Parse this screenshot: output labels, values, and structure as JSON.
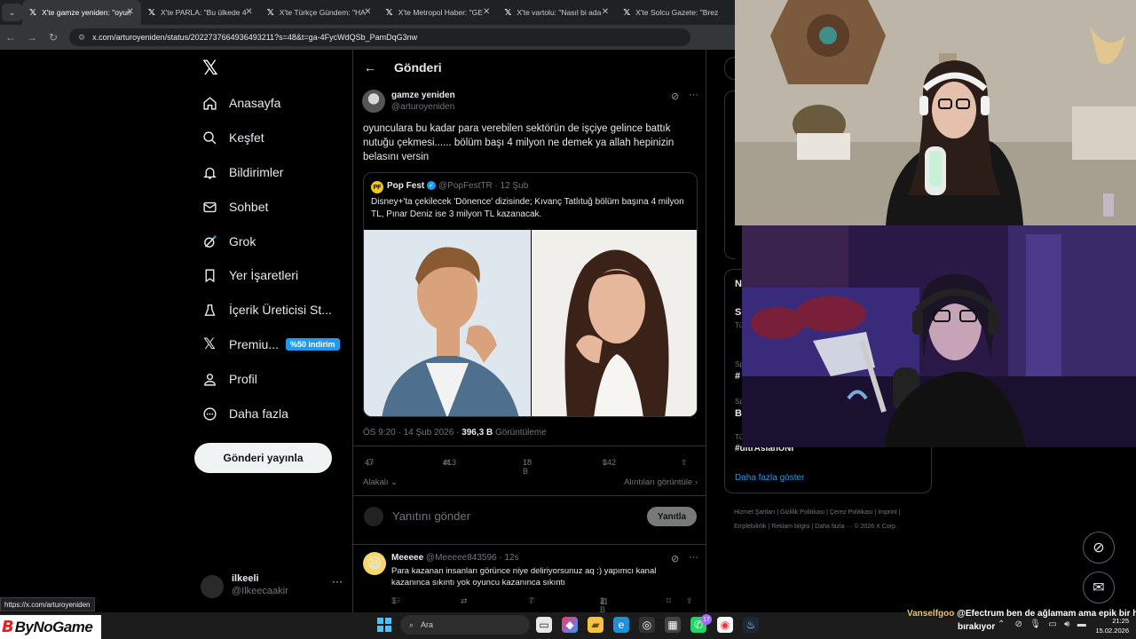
{
  "browser": {
    "tabs": [
      {
        "label": "X'te gamze yeniden: \"oyuncu",
        "active": true
      },
      {
        "label": "X'te PARLA: \"Bu ülkede 4",
        "active": false
      },
      {
        "label": "X'te Türkçe Gündem: \"HA",
        "active": false
      },
      {
        "label": "X'te Metropol Haber: \"GE",
        "active": false
      },
      {
        "label": "X'te vartolu: \"Nasıl bi ada",
        "active": false
      },
      {
        "label": "X'te Solcu Gazete: \"Brez",
        "active": false
      }
    ],
    "url": "x.com/arturoyeniden/status/2022737664936493211?s=48&t=ga-4FycWdQSb_PamDqG3nw",
    "hover_link": "https://x.com/arturoyeniden"
  },
  "sidebar": {
    "items": [
      {
        "label": "Anasayfa",
        "icon": "home-icon"
      },
      {
        "label": "Keşfet",
        "icon": "search-icon"
      },
      {
        "label": "Bildirimler",
        "icon": "bell-icon"
      },
      {
        "label": "Sohbet",
        "icon": "mail-icon"
      },
      {
        "label": "Grok",
        "icon": "grok-icon"
      },
      {
        "label": "Yer İşaretleri",
        "icon": "bookmark-icon"
      },
      {
        "label": "İçerik Üreticisi St...",
        "icon": "creator-studio-icon"
      },
      {
        "label": "Premiu...",
        "icon": "x-premium-icon",
        "badge": "%50 indirim"
      },
      {
        "label": "Profil",
        "icon": "profile-icon"
      },
      {
        "label": "Daha fazla",
        "icon": "more-circle-icon"
      }
    ],
    "post_button": "Gönderi yayınla",
    "account": {
      "name": "ilkeeli",
      "handle": "@Ilkeecaakir"
    }
  },
  "post": {
    "header_title": "Gönderi",
    "author_name": "gamze yeniden",
    "author_handle": "@arturoyeniden",
    "text": "oyunculara bu kadar para verebilen sektörün de işçiye gelince battık nutuğu çekmesi...... bölüm başı 4 milyon ne demek ya allah hepinizin belasını versin",
    "quote": {
      "name": "Pop Fest",
      "handle_date": "@PopFestTR · 12 Şub",
      "text": "Disney+'ta çekilecek 'Dönence' dizisinde; Kıvanç Tatlıtuğ bölüm başına 4 milyon TL, Pınar Deniz ise 3 milyon TL kazanacak."
    },
    "time": "ÖS 9:20 · 14 Şub 2026 · ",
    "views_count": "396,3 B",
    "views_label": " Görüntüleme",
    "actions": {
      "replies": "47",
      "reposts": "413",
      "likes": "18 B",
      "bookmarks": "142"
    },
    "sort_label": "Alakalı",
    "quotes_link": "Alıntıları görüntüle",
    "reply_placeholder": "Yanıtını gönder",
    "reply_button": "Yanıtla"
  },
  "comment": {
    "name": "Meeeee",
    "handle_time": "@Meeeee843596 · 12s",
    "text": "Para kazanan insanları görünce niye deliriyorsunuz aq :) yapımcı kanal kazanınca sıkıntı yok oyuncu kazanınca sıkıntı",
    "actions": {
      "replies": "3",
      "likes": "7",
      "views": "2 B"
    }
  },
  "right": {
    "trend_letters": [
      "N",
      "S",
      "#",
      "B"
    ],
    "trend_small": [
      "Tü",
      "Sp",
      "Sp",
      "Tü"
    ],
    "trend_tag": "#ultrAsianUNI",
    "show_more": "Daha fazla göster",
    "footer": "Hizmet Şartları  |  Gizlilik Politikası  |  Çerez Politikası  |  Imprint  |  Erişilebilirlik  |  Reklam bilgisi  |  Daha fazla ···  © 2026 X Corp."
  },
  "taskbar": {
    "brand": "ByNoGame",
    "search": "Ara",
    "chat_user": "Vanselfgoo",
    "chat_message": "@Efectrum ben de ağlamam ama epik bir his",
    "chat_message2": "bırakıyor",
    "time": "21:25",
    "date": "15.02.2026",
    "whatsapp_badge": "17"
  },
  "colors": {
    "accent": "#1d9bf0",
    "background": "#000000",
    "border": "#2f3336",
    "muted": "#71767b"
  }
}
